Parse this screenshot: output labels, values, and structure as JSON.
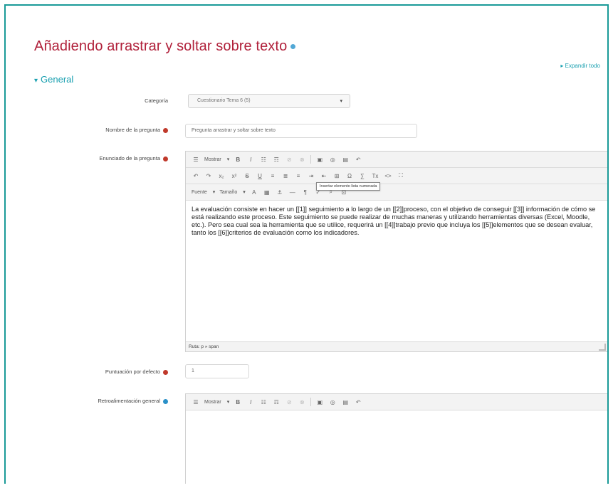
{
  "page": {
    "title": "Añadiendo arrastrar y soltar sobre texto",
    "expand_all": "▸ Expandir todo"
  },
  "section": {
    "caret": "▾",
    "label": "General"
  },
  "fields": {
    "category": {
      "label": "Categoría",
      "value": "Cuestionario Tema 6 (5)"
    },
    "question_name": {
      "label": "Nombre de la pregunta",
      "value": "Pregunta arrastrar y soltar sobre texto"
    },
    "question_text": {
      "label": "Enunciado de la pregunta",
      "content": "La evaluación consiste en hacer un [[1]] seguimiento a lo largo de un [[2]]proceso, con el objetivo de conseguir [[3]] información de cómo se está realizando este proceso. Este seguimiento se puede realizar de muchas maneras y utilizando herramientas diversas (Excel, Moodle, etc.). Pero sea cual sea la herramienta que se utilice, requerirá un [[4]]trabajo previo que incluya los [[5]]elementos que se desean evaluar, tanto los [[6]]criterios de evaluación como los indicadores.",
      "status_path": "Ruta: p » span"
    },
    "default_mark": {
      "label": "Puntuación por defecto",
      "value": "1"
    },
    "general_feedback": {
      "label": "Retroalimentación general",
      "content": ""
    }
  },
  "editor": {
    "font_dropdown": "Mostrar",
    "family_dropdown": "Fuente",
    "size_dropdown": "Tamaño",
    "tooltip": "Insertar elemento lista numerada"
  },
  "colors": {
    "title": "#b0203a",
    "accent": "#1aa0b0",
    "frame": "#1a9a98",
    "required": "#c0392b"
  }
}
